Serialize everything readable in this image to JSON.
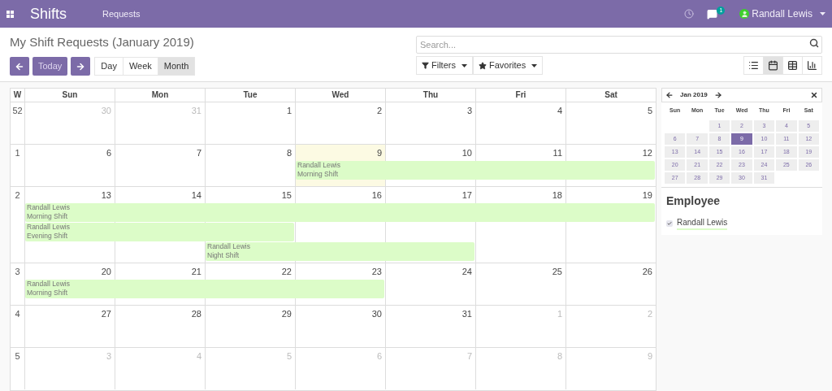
{
  "navbar": {
    "app_title": "Shifts",
    "menu": [
      "Requests"
    ],
    "chat_badge": "1",
    "user": "Randall Lewis"
  },
  "control_panel": {
    "title": "My Shift Requests (January 2019)",
    "today_button": "Today",
    "scales": [
      {
        "label": "Day",
        "selected": false
      },
      {
        "label": "Week",
        "selected": false
      },
      {
        "label": "Month",
        "selected": true
      }
    ],
    "search": {
      "placeholder": "Search..."
    },
    "filters": [
      "Filters",
      "Favorites"
    ],
    "views": [
      {
        "kind": "list",
        "selected": false
      },
      {
        "kind": "calendar",
        "selected": true
      },
      {
        "kind": "pivot",
        "selected": false
      },
      {
        "kind": "graph",
        "selected": false
      }
    ]
  },
  "calendar": {
    "week_header": "W",
    "day_names": [
      "Sun",
      "Mon",
      "Tue",
      "Wed",
      "Thu",
      "Fri",
      "Sat"
    ],
    "weeks": [
      {
        "number": "52",
        "days": [
          {
            "label": "30",
            "muted": true,
            "today": false
          },
          {
            "label": "31",
            "muted": true,
            "today": false
          },
          {
            "label": "1",
            "muted": false,
            "today": false
          },
          {
            "label": "2",
            "muted": false,
            "today": false
          },
          {
            "label": "3",
            "muted": false,
            "today": false
          },
          {
            "label": "4",
            "muted": false,
            "today": false
          },
          {
            "label": "5",
            "muted": false,
            "today": false
          }
        ]
      },
      {
        "number": "1",
        "days": [
          {
            "label": "6",
            "muted": false,
            "today": false
          },
          {
            "label": "7",
            "muted": false,
            "today": false
          },
          {
            "label": "8",
            "muted": false,
            "today": false
          },
          {
            "label": "9",
            "muted": false,
            "today": true
          },
          {
            "label": "10",
            "muted": false,
            "today": false
          },
          {
            "label": "11",
            "muted": false,
            "today": false
          },
          {
            "label": "12",
            "muted": false,
            "today": false
          }
        ],
        "lanes": [
          [
            {
              "kind": "empty"
            },
            {
              "kind": "empty"
            },
            {
              "kind": "empty"
            },
            {
              "kind": "start",
              "name": "Randall Lewis",
              "shift": "Morning Shift"
            },
            {
              "kind": "continue"
            },
            {
              "kind": "continue"
            },
            {
              "kind": "continue"
            }
          ]
        ]
      },
      {
        "number": "2",
        "days": [
          {
            "label": "13",
            "muted": false,
            "today": false
          },
          {
            "label": "14",
            "muted": false,
            "today": false
          },
          {
            "label": "15",
            "muted": false,
            "today": false
          },
          {
            "label": "16",
            "muted": false,
            "today": false
          },
          {
            "label": "17",
            "muted": false,
            "today": false
          },
          {
            "label": "18",
            "muted": false,
            "today": false
          },
          {
            "label": "19",
            "muted": false,
            "today": false
          }
        ],
        "lanes": [
          [
            {
              "kind": "start",
              "name": "Randall Lewis",
              "shift": "Morning Shift"
            },
            {
              "kind": "continue"
            },
            {
              "kind": "continue"
            },
            {
              "kind": "continue"
            },
            {
              "kind": "continue"
            },
            {
              "kind": "continue"
            },
            {
              "kind": "continue"
            }
          ],
          [
            {
              "kind": "start",
              "name": "Randall Lewis",
              "shift": "Evening Shift"
            },
            {
              "kind": "continue"
            },
            {
              "kind": "continue"
            },
            {
              "kind": "empty"
            },
            {
              "kind": "empty"
            },
            {
              "kind": "empty"
            },
            {
              "kind": "empty"
            }
          ],
          [
            {
              "kind": "empty"
            },
            {
              "kind": "empty"
            },
            {
              "kind": "start",
              "name": "Randall Lewis",
              "shift": "Night Shift"
            },
            {
              "kind": "continue"
            },
            {
              "kind": "continue"
            },
            {
              "kind": "empty"
            },
            {
              "kind": "empty"
            }
          ]
        ]
      },
      {
        "number": "3",
        "days": [
          {
            "label": "20",
            "muted": false,
            "today": false
          },
          {
            "label": "21",
            "muted": false,
            "today": false
          },
          {
            "label": "22",
            "muted": false,
            "today": false
          },
          {
            "label": "23",
            "muted": false,
            "today": false
          },
          {
            "label": "24",
            "muted": false,
            "today": false
          },
          {
            "label": "25",
            "muted": false,
            "today": false
          },
          {
            "label": "26",
            "muted": false,
            "today": false
          }
        ],
        "lanes": [
          [
            {
              "kind": "start",
              "name": "Randall Lewis",
              "shift": "Morning Shift"
            },
            {
              "kind": "continue"
            },
            {
              "kind": "continue"
            },
            {
              "kind": "continue"
            },
            {
              "kind": "empty"
            },
            {
              "kind": "empty"
            },
            {
              "kind": "empty"
            }
          ]
        ]
      },
      {
        "number": "4",
        "days": [
          {
            "label": "27",
            "muted": false,
            "today": false
          },
          {
            "label": "28",
            "muted": false,
            "today": false
          },
          {
            "label": "29",
            "muted": false,
            "today": false
          },
          {
            "label": "30",
            "muted": false,
            "today": false
          },
          {
            "label": "31",
            "muted": false,
            "today": false
          },
          {
            "label": "1",
            "muted": true,
            "today": false
          },
          {
            "label": "2",
            "muted": true,
            "today": false
          }
        ]
      },
      {
        "number": "5",
        "days": [
          {
            "label": "3",
            "muted": true,
            "today": false
          },
          {
            "label": "4",
            "muted": true,
            "today": false
          },
          {
            "label": "5",
            "muted": true,
            "today": false
          },
          {
            "label": "6",
            "muted": true,
            "today": false
          },
          {
            "label": "7",
            "muted": true,
            "today": false
          },
          {
            "label": "8",
            "muted": true,
            "today": false
          },
          {
            "label": "9",
            "muted": true,
            "today": false
          }
        ]
      }
    ]
  },
  "sidebar": {
    "mini_calendar": {
      "title": "Jan 2019",
      "day_names": [
        "Sun",
        "Mon",
        "Tue",
        "Wed",
        "Thu",
        "Fri",
        "Sat"
      ],
      "weeks": [
        [
          {
            "kind": "blank"
          },
          {
            "kind": "blank"
          },
          {
            "kind": "day",
            "label": "1",
            "selected": false
          },
          {
            "kind": "day",
            "label": "2",
            "selected": false
          },
          {
            "kind": "day",
            "label": "3",
            "selected": false
          },
          {
            "kind": "day",
            "label": "4",
            "selected": false
          },
          {
            "kind": "day",
            "label": "5",
            "selected": false
          }
        ],
        [
          {
            "kind": "day",
            "label": "6",
            "selected": false
          },
          {
            "kind": "day",
            "label": "7",
            "selected": false
          },
          {
            "kind": "day",
            "label": "8",
            "selected": false
          },
          {
            "kind": "day",
            "label": "9",
            "selected": true
          },
          {
            "kind": "day",
            "label": "10",
            "selected": false
          },
          {
            "kind": "day",
            "label": "11",
            "selected": false
          },
          {
            "kind": "day",
            "label": "12",
            "selected": false
          }
        ],
        [
          {
            "kind": "day",
            "label": "13",
            "selected": false
          },
          {
            "kind": "day",
            "label": "14",
            "selected": false
          },
          {
            "kind": "day",
            "label": "15",
            "selected": false
          },
          {
            "kind": "day",
            "label": "16",
            "selected": false
          },
          {
            "kind": "day",
            "label": "17",
            "selected": false
          },
          {
            "kind": "day",
            "label": "18",
            "selected": false
          },
          {
            "kind": "day",
            "label": "19",
            "selected": false
          }
        ],
        [
          {
            "kind": "day",
            "label": "20",
            "selected": false
          },
          {
            "kind": "day",
            "label": "21",
            "selected": false
          },
          {
            "kind": "day",
            "label": "22",
            "selected": false
          },
          {
            "kind": "day",
            "label": "23",
            "selected": false
          },
          {
            "kind": "day",
            "label": "24",
            "selected": false
          },
          {
            "kind": "day",
            "label": "25",
            "selected": false
          },
          {
            "kind": "day",
            "label": "26",
            "selected": false
          }
        ],
        [
          {
            "kind": "day",
            "label": "27",
            "selected": false
          },
          {
            "kind": "day",
            "label": "28",
            "selected": false
          },
          {
            "kind": "day",
            "label": "29",
            "selected": false
          },
          {
            "kind": "day",
            "label": "30",
            "selected": false
          },
          {
            "kind": "day",
            "label": "31",
            "selected": false
          },
          {
            "kind": "blank"
          },
          {
            "kind": "blank"
          }
        ]
      ]
    },
    "filter_title": "Employee",
    "employees": [
      {
        "name": "Randall Lewis",
        "checked": true,
        "color": "#dcfcc8"
      }
    ]
  }
}
